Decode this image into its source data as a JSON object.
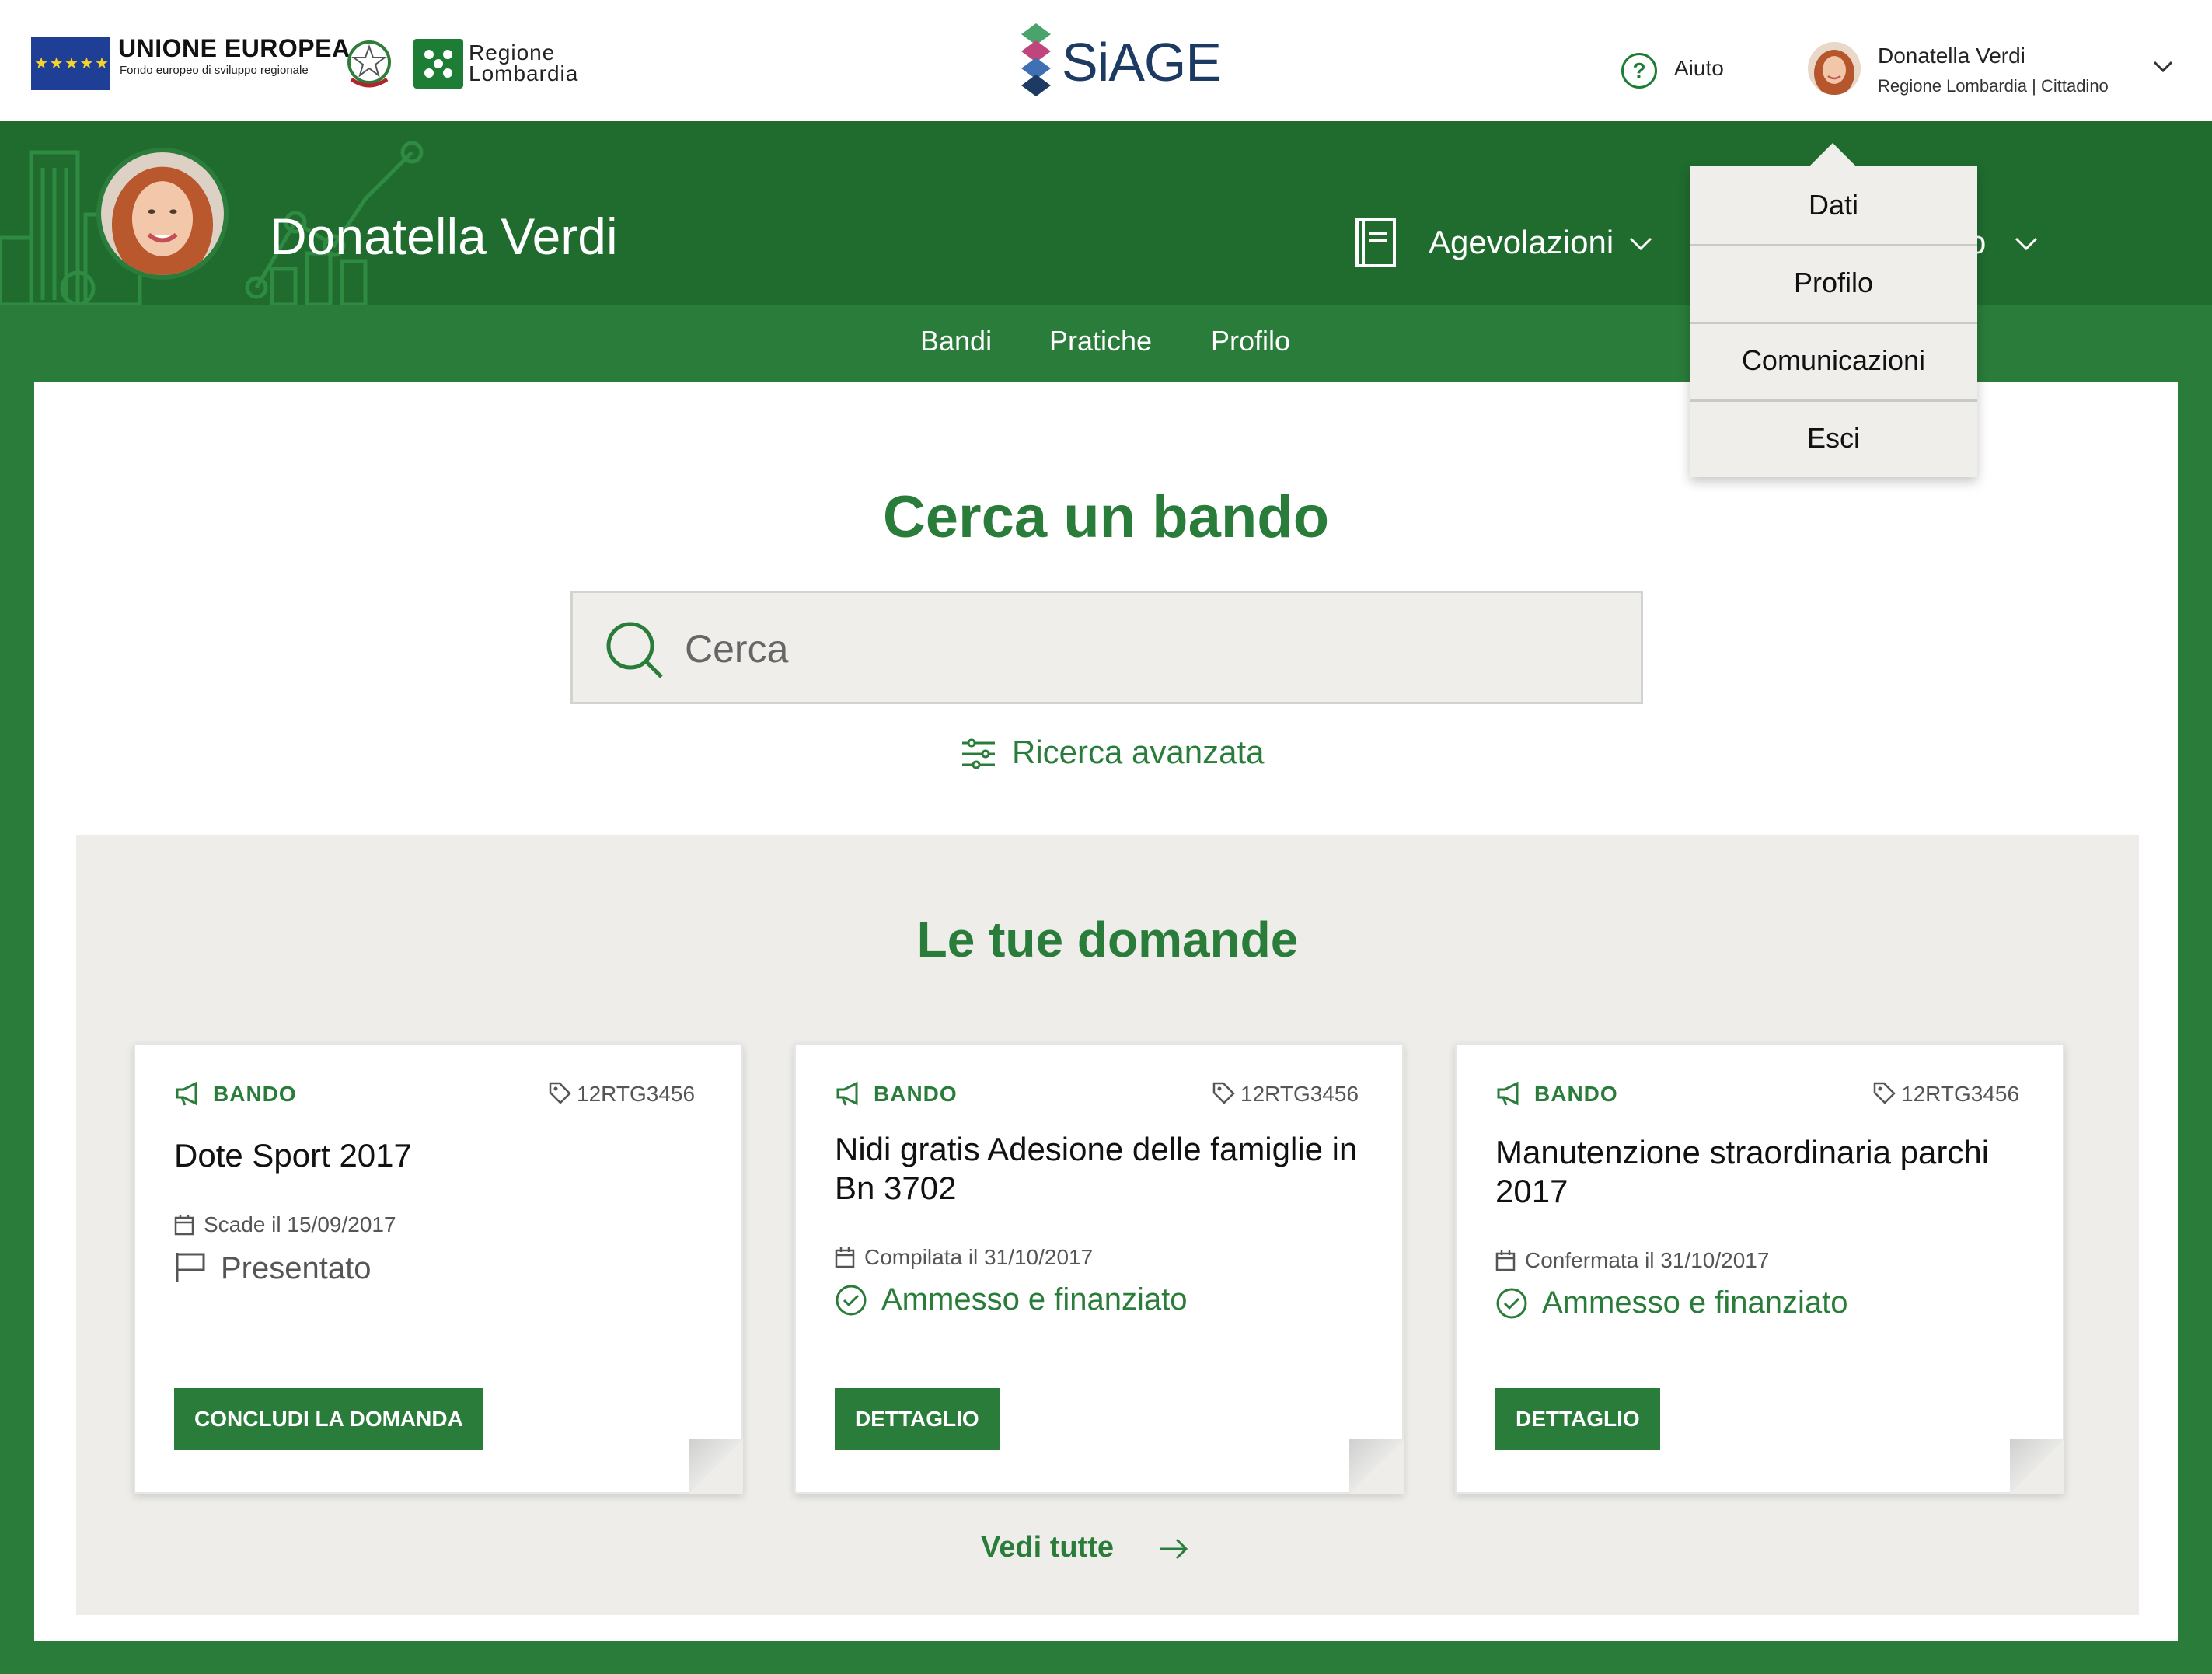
{
  "header": {
    "eu_title": "UNIONE EUROPEA",
    "eu_subtitle": "Fondo europeo di sviluppo regionale",
    "region_logo_text_line1": "Regione",
    "region_logo_text_line2": "Lombardia",
    "app_logo_text": "SiAGE",
    "help_label": "Aiuto",
    "user_name": "Donatella Verdi",
    "user_org": "Regione Lombardia",
    "user_role": "Cittadino",
    "user_role_full": "Regione Lombardia  |  Cittadino"
  },
  "profile_band": {
    "name": "Donatella Verdi",
    "nav_agevolazioni": "Agevolazioni",
    "nav_hidden_suffix": "o"
  },
  "subnav": {
    "items": [
      "Bandi",
      "Pratiche",
      "Profilo"
    ]
  },
  "search": {
    "title": "Cerca un bando",
    "placeholder": "Cerca",
    "advanced_label": "Ricerca avanzata"
  },
  "domande": {
    "title": "Le tue domande",
    "cards": [
      {
        "type": "BANDO",
        "code": "12RTG3456",
        "title": "Dote Sport 2017",
        "date_text": "Scade il 15/09/2017",
        "status": "Presentato",
        "status_icon": "flag-icon",
        "button": "CONCLUDI LA DOMANDA"
      },
      {
        "type": "BANDO",
        "code": "12RTG3456",
        "title": "Nidi gratis Adesione delle famiglie in Bn 3702",
        "date_text": "Compilata il 31/10/2017",
        "status": "Ammesso e finanziato",
        "status_icon": "check-circle-icon",
        "button": "DETTAGLIO"
      },
      {
        "type": "BANDO",
        "code": "12RTG3456",
        "title": "Manutenzione straordinaria parchi 2017",
        "date_text": "Confermata il 31/10/2017",
        "status": "Ammesso e finanziato",
        "status_icon": "check-circle-icon",
        "button": "DETTAGLIO"
      }
    ],
    "see_all": "Vedi tutte"
  },
  "user_menu": {
    "items": [
      "Dati",
      "Profilo",
      "Comunicazioni",
      "Esci"
    ]
  },
  "colors": {
    "brand_green": "#2a7c3a",
    "band_green": "#1f6c2e",
    "card_bg": "#ffffff",
    "panel_bg": "#eeede9",
    "siage_blue": "#1d3a63"
  }
}
